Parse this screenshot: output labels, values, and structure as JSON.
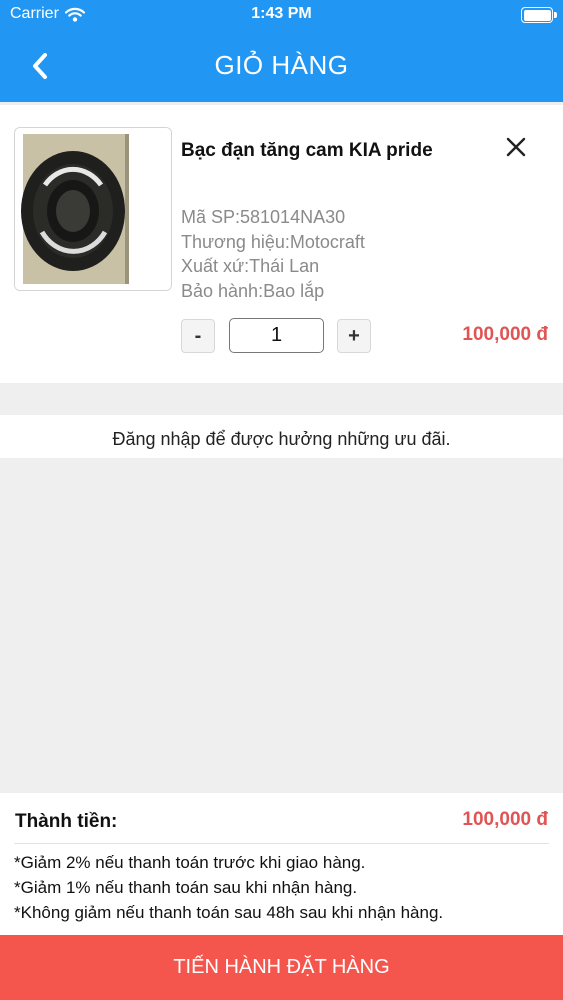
{
  "status_bar": {
    "carrier": "Carrier",
    "time": "1:43 PM"
  },
  "header": {
    "title": "GIỎ HÀNG"
  },
  "cart_item": {
    "name": "Bạc đạn tăng cam KIA pride",
    "sku": "Mã SP:581014NA30",
    "brand": "Thương hiệu:Motocraft",
    "origin": "Xuất xứ:Thái Lan",
    "warranty": "Bảo hành:Bao lắp",
    "qty_minus": "-",
    "quantity": "1",
    "qty_plus": "+",
    "price": "100,000 đ"
  },
  "login_banner": "Đăng nhập để được hưởng những ưu đãi.",
  "summary": {
    "total_label": "Thành tiền:",
    "total_value": "100,000 đ",
    "notes": [
      "*Giảm 2% nếu thanh toán trước khi giao hàng.",
      "*Giảm 1% nếu thanh toán sau khi nhận hàng.",
      "*Không giảm nếu thanh toán sau 48h sau khi nhận hàng."
    ]
  },
  "order_button": "TIẾN HÀNH ĐẶT HÀNG",
  "colors": {
    "header": "#2196f3",
    "price": "#e05454",
    "order_button": "#f4564e",
    "background": "#efefef"
  },
  "icons": {
    "back": "chevron-left-icon",
    "remove": "close-icon",
    "wifi": "wifi-icon",
    "battery": "battery-icon"
  }
}
